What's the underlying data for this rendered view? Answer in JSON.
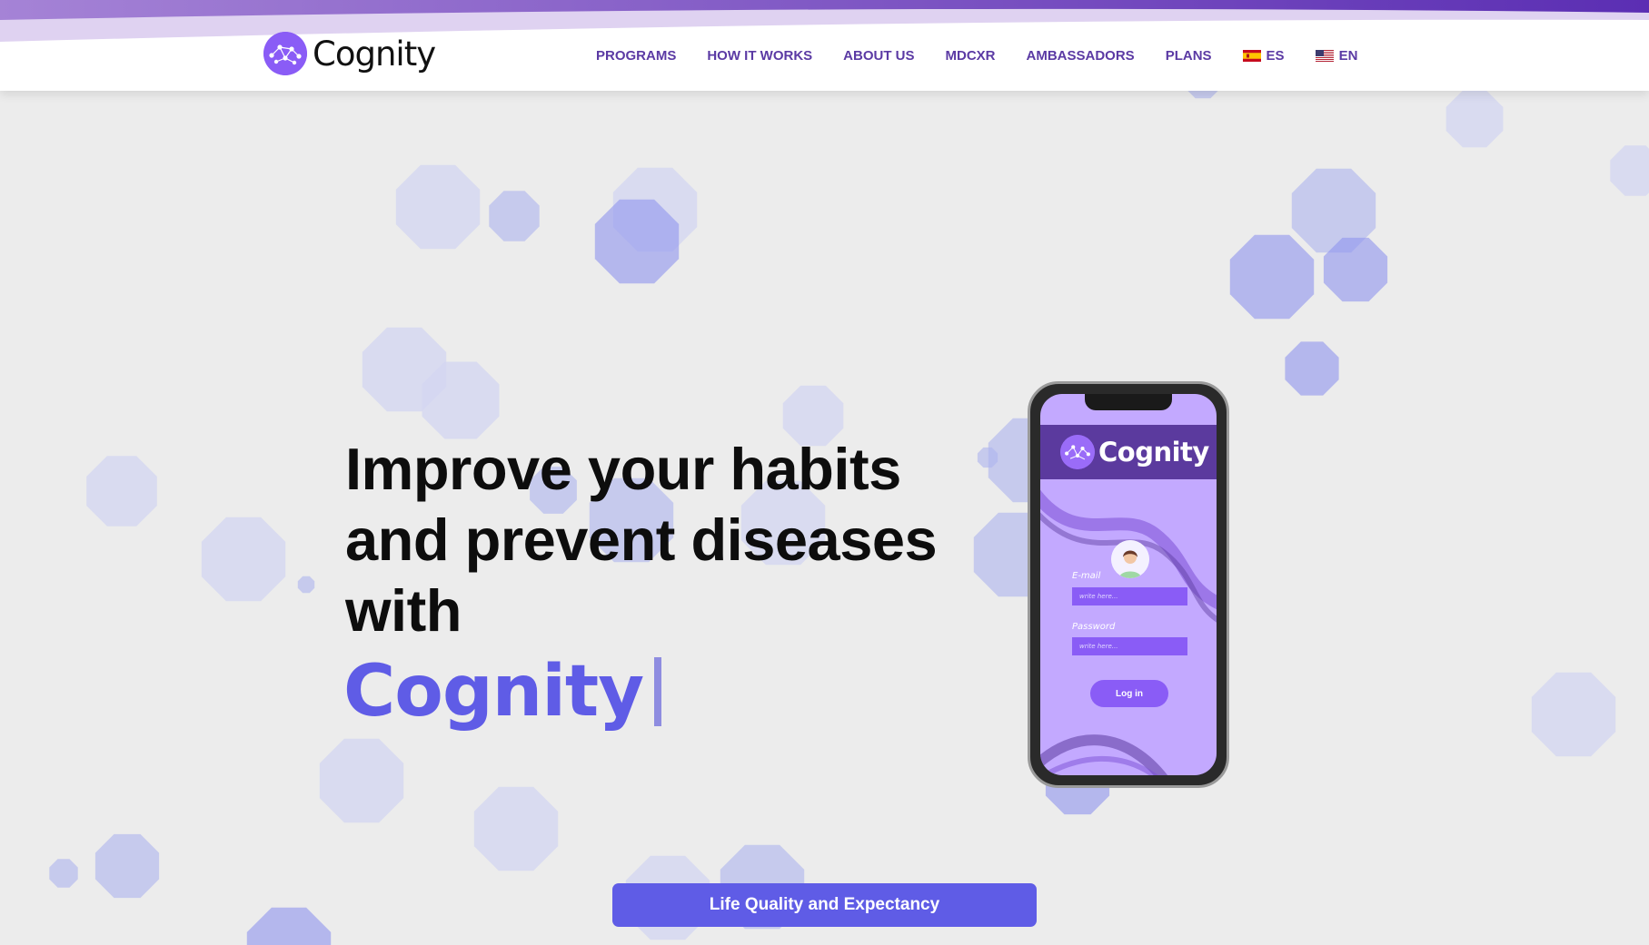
{
  "brand": {
    "name": "Cognity"
  },
  "nav": {
    "items": [
      "PROGRAMS",
      "HOW IT WORKS",
      "ABOUT US",
      "MDCXR",
      "AMBASSADORS",
      "PLANS"
    ],
    "languages": [
      "ES",
      "EN"
    ]
  },
  "hero": {
    "heading_lines": [
      "Improve your habits",
      "and prevent diseases",
      "with"
    ],
    "brand_word": "Cognity"
  },
  "phone": {
    "app_name": "Cognity",
    "email_label": "E-mail",
    "email_placeholder": "write here...",
    "password_label": "Password",
    "password_placeholder": "write here...",
    "login_label": "Log in"
  },
  "cta": {
    "label": "Life Quality and Expectancy"
  },
  "colors": {
    "accent": "#5f5ce6",
    "nav_text": "#5b3aa4",
    "phone_bg": "#c3a9ff",
    "phone_header": "#5b3a9e",
    "header_gradient_start": "#a583d6",
    "header_gradient_end": "#5b2eb3",
    "shape_light": "#d3d6f1",
    "shape_medium": "#aeb4ee",
    "shape_strong": "#8f95ee"
  }
}
